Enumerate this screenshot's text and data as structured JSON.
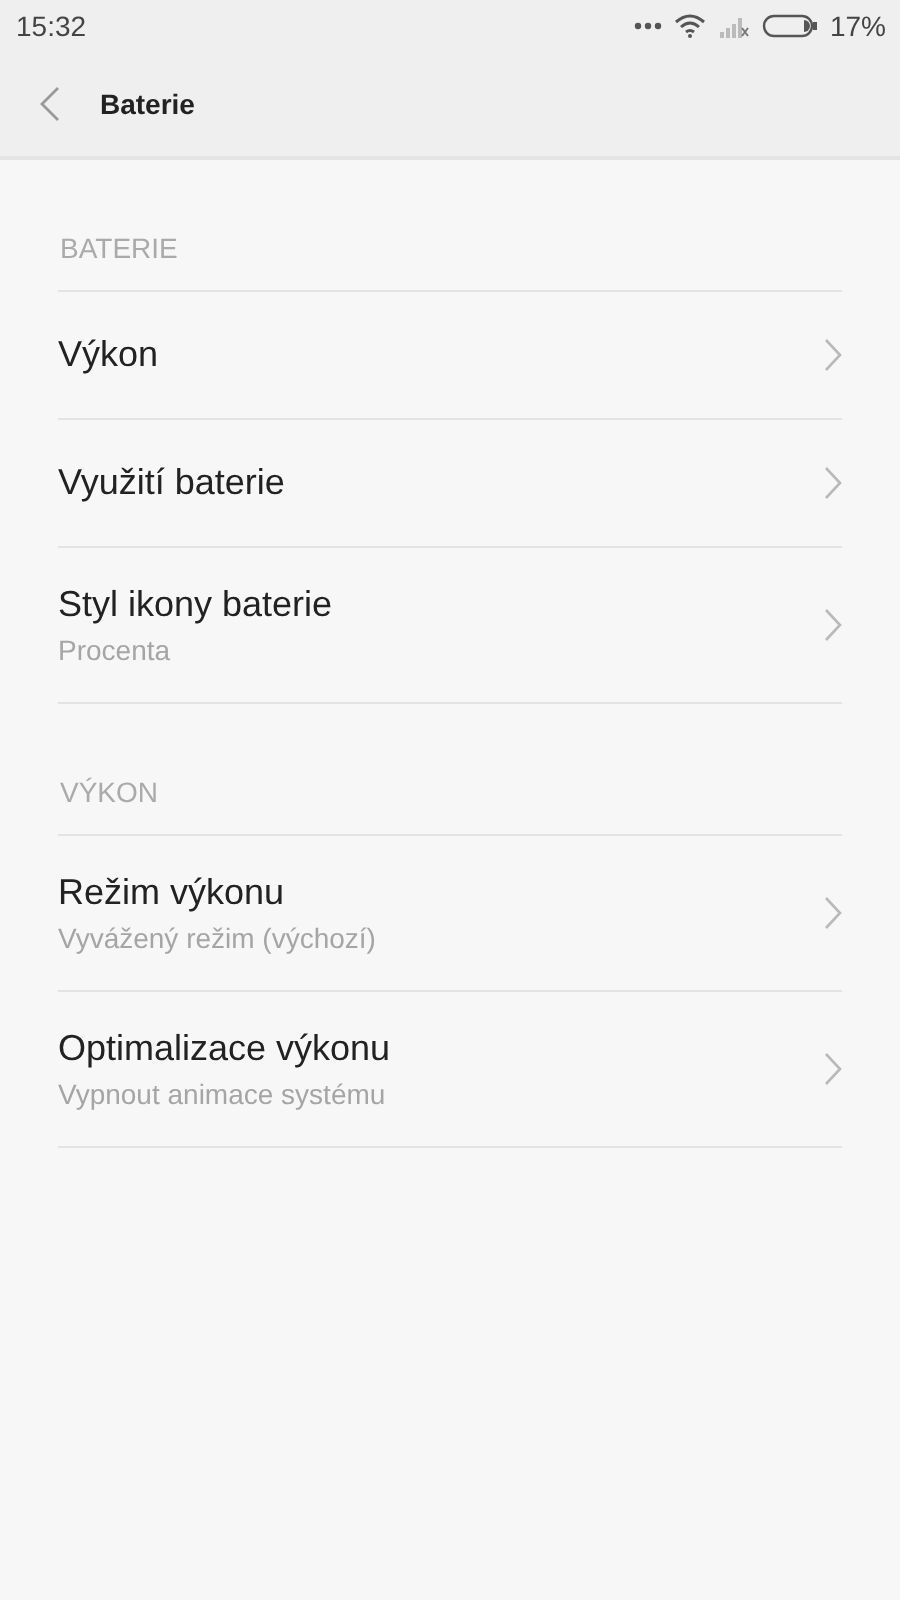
{
  "status_bar": {
    "time": "15:32",
    "battery": "17%"
  },
  "header": {
    "title": "Baterie"
  },
  "sections": [
    {
      "title": "BATERIE",
      "items": [
        {
          "title": "Výkon"
        },
        {
          "title": "Využití baterie"
        },
        {
          "title": "Styl ikony baterie",
          "subtitle": "Procenta"
        }
      ]
    },
    {
      "title": "VÝKON",
      "items": [
        {
          "title": "Režim výkonu",
          "subtitle": "Vyvážený režim (výchozí)"
        },
        {
          "title": "Optimalizace výkonu",
          "subtitle": "Vypnout animace systému"
        }
      ]
    }
  ]
}
